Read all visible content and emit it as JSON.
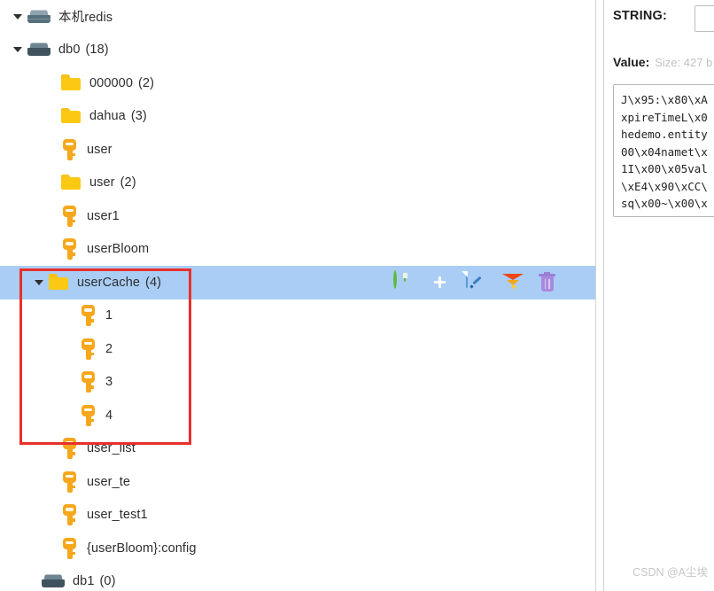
{
  "tree": {
    "rows": [
      {
        "label": "本机redis",
        "count": "",
        "icon": "server-light-icon",
        "indent": 14,
        "expander": "open",
        "selected": false
      },
      {
        "label": "db0",
        "count": "(18)",
        "icon": "server-icon",
        "indent": 14,
        "expander": "open",
        "selected": false
      },
      {
        "label": "000000",
        "count": "(2)",
        "icon": "folder-icon",
        "indent": 52,
        "expander": "blank",
        "selected": false
      },
      {
        "label": "dahua",
        "count": "(3)",
        "icon": "folder-icon",
        "indent": 52,
        "expander": "blank",
        "selected": false
      },
      {
        "label": "user",
        "count": "",
        "icon": "key-icon",
        "indent": 52,
        "expander": "blank",
        "selected": false
      },
      {
        "label": "user",
        "count": "(2)",
        "icon": "folder-icon",
        "indent": 52,
        "expander": "blank",
        "selected": false
      },
      {
        "label": "user1",
        "count": "",
        "icon": "key-icon",
        "indent": 52,
        "expander": "blank",
        "selected": false
      },
      {
        "label": "userBloom",
        "count": "",
        "icon": "key-icon",
        "indent": 52,
        "expander": "blank",
        "selected": false
      },
      {
        "label": "userCache",
        "count": "(4)",
        "icon": "folder-icon",
        "indent": 38,
        "expander": "open",
        "selected": true
      },
      {
        "label": "1",
        "count": "",
        "icon": "key-icon",
        "indent": 73,
        "expander": "blank",
        "selected": false
      },
      {
        "label": "2",
        "count": "",
        "icon": "key-icon",
        "indent": 73,
        "expander": "blank",
        "selected": false
      },
      {
        "label": "3",
        "count": "",
        "icon": "key-icon",
        "indent": 73,
        "expander": "blank",
        "selected": false
      },
      {
        "label": "4",
        "count": "",
        "icon": "key-icon",
        "indent": 73,
        "expander": "blank",
        "selected": false
      },
      {
        "label": "user_list",
        "count": "",
        "icon": "key-icon",
        "indent": 52,
        "expander": "blank",
        "selected": false
      },
      {
        "label": "user_te",
        "count": "",
        "icon": "key-icon",
        "indent": 52,
        "expander": "blank",
        "selected": false
      },
      {
        "label": "user_test1",
        "count": "",
        "icon": "key-icon",
        "indent": 52,
        "expander": "blank",
        "selected": false
      },
      {
        "label": "{userBloom}:config",
        "count": "",
        "icon": "key-icon",
        "indent": 52,
        "expander": "blank",
        "selected": false
      },
      {
        "label": "db1",
        "count": "(0)",
        "icon": "server-icon",
        "indent": 30,
        "expander": "blank",
        "selected": false
      }
    ]
  },
  "row_toolbar": {
    "buttons": [
      {
        "name": "refresh-icon",
        "title": "Refresh"
      },
      {
        "name": "add-icon",
        "title": "Add new key"
      },
      {
        "name": "edit-icon",
        "title": "Edit"
      },
      {
        "name": "filter-icon",
        "title": "Filter"
      },
      {
        "name": "delete-icon",
        "title": "Delete"
      }
    ]
  },
  "annotation": {
    "color": "#e8302a",
    "shape": "rectangle"
  },
  "detail": {
    "type_label": "STRING:",
    "key_name_value": "",
    "value_label": "Value:",
    "size_hint": "Size: 427 b",
    "value_lines": [
      "J\\x95:\\x80\\xA",
      "xpireTimeL\\x0",
      "hedemo.entity",
      "00\\x04namet\\x",
      "1I\\x00\\x05val",
      "\\xE4\\x90\\xCC\\",
      "sq\\x00~\\x00\\x"
    ]
  },
  "watermark": {
    "text": "CSDN @A尘埃"
  },
  "colors": {
    "selection": "#aacdf5",
    "annotation": "#e8302a",
    "folder": "#fbc913",
    "key": "#f6a71b",
    "server": "#3f535e"
  }
}
